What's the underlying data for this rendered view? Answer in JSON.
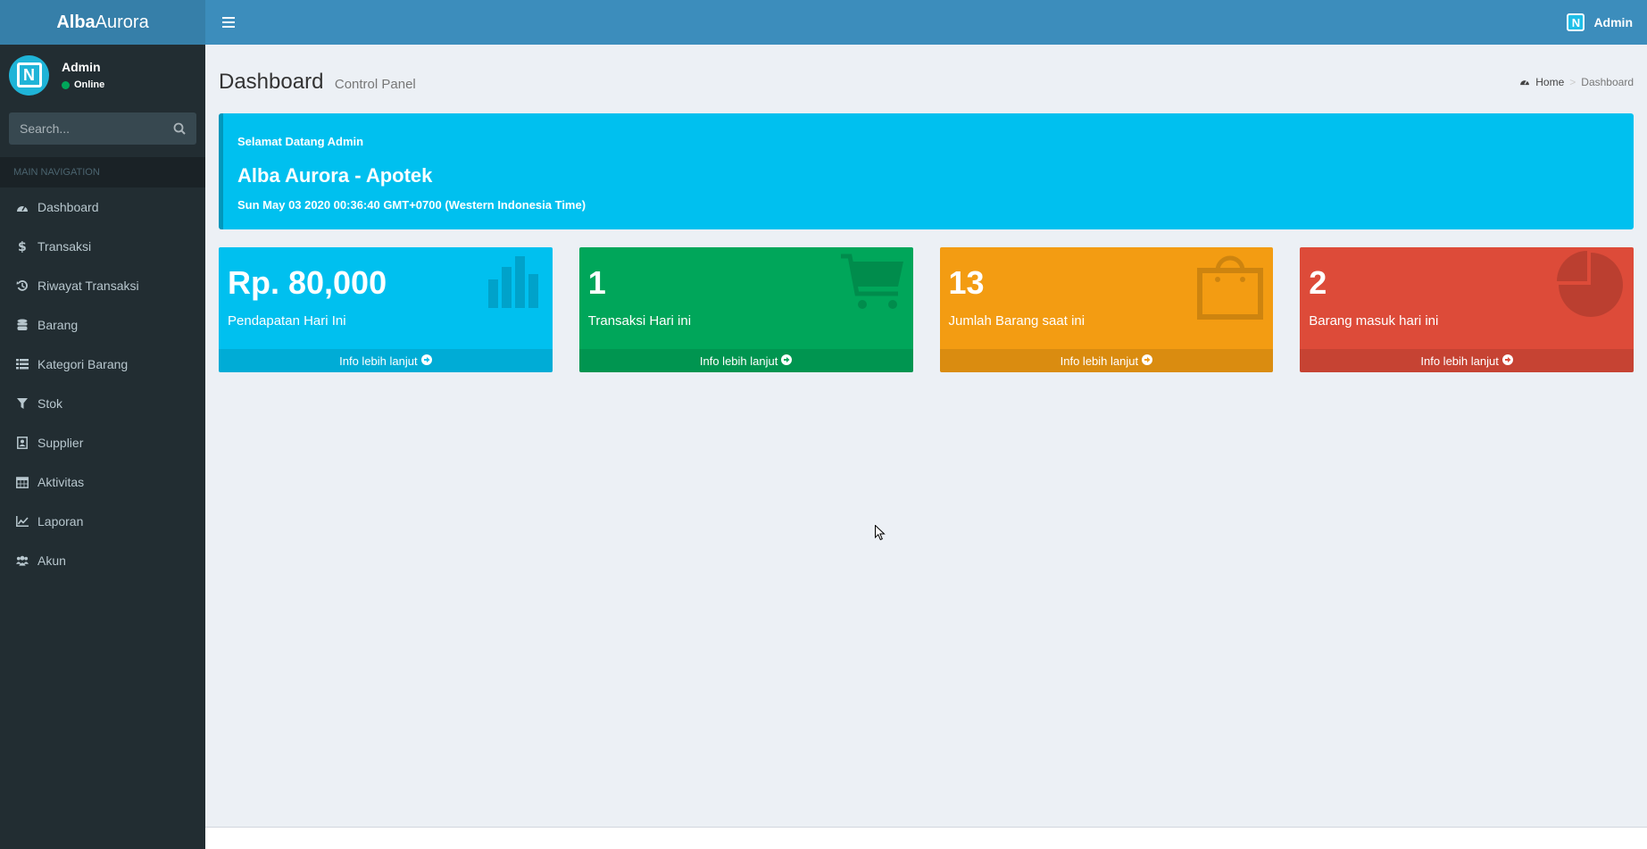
{
  "header": {
    "logo_bold": "Alba",
    "logo_light": "Aurora",
    "menu_toggle_icon": "bars-icon",
    "user": {
      "avatar_letter": "N",
      "name": "Admin"
    }
  },
  "sidebar": {
    "user": {
      "avatar_letter": "N",
      "name": "Admin",
      "status": "Online"
    },
    "search": {
      "placeholder": "Search...",
      "icon": "search-icon"
    },
    "nav_header": "MAIN NAVIGATION",
    "items": [
      {
        "label": "Dashboard",
        "icon": "dashboard-icon"
      },
      {
        "label": "Transaksi",
        "icon": "dollar-icon"
      },
      {
        "label": "Riwayat Transaksi",
        "icon": "history-icon"
      },
      {
        "label": "Barang",
        "icon": "database-icon"
      },
      {
        "label": "Kategori Barang",
        "icon": "list-icon"
      },
      {
        "label": "Stok",
        "icon": "filter-icon"
      },
      {
        "label": "Supplier",
        "icon": "address-book-icon"
      },
      {
        "label": "Aktivitas",
        "icon": "calendar-icon"
      },
      {
        "label": "Laporan",
        "icon": "line-chart-icon"
      },
      {
        "label": "Akun",
        "icon": "users-icon"
      }
    ]
  },
  "content_header": {
    "title": "Dashboard",
    "subtitle": "Control Panel",
    "breadcrumb": {
      "home": "Home",
      "current": "Dashboard"
    }
  },
  "callout": {
    "greeting": "Selamat Datang Admin",
    "title": "Alba Aurora - Apotek",
    "date": "Sun May 03 2020 00:36:40 GMT+0700 (Western Indonesia Time)"
  },
  "boxes": [
    {
      "value": "Rp. 80,000",
      "label": "Pendapatan Hari Ini",
      "footer": "Info lebih lanjut",
      "icon": "bar-chart-icon",
      "color": "#00c0ef"
    },
    {
      "value": "1",
      "label": "Transaksi Hari ini",
      "footer": "Info lebih lanjut",
      "icon": "shopping-cart-icon",
      "color": "#00a65a"
    },
    {
      "value": "13",
      "label": "Jumlah Barang saat ini",
      "footer": "Info lebih lanjut",
      "icon": "shopping-bag-icon",
      "color": "#f39c12"
    },
    {
      "value": "2",
      "label": "Barang masuk hari ini",
      "footer": "Info lebih lanjut",
      "icon": "pie-chart-icon",
      "color": "#dd4b39"
    }
  ]
}
